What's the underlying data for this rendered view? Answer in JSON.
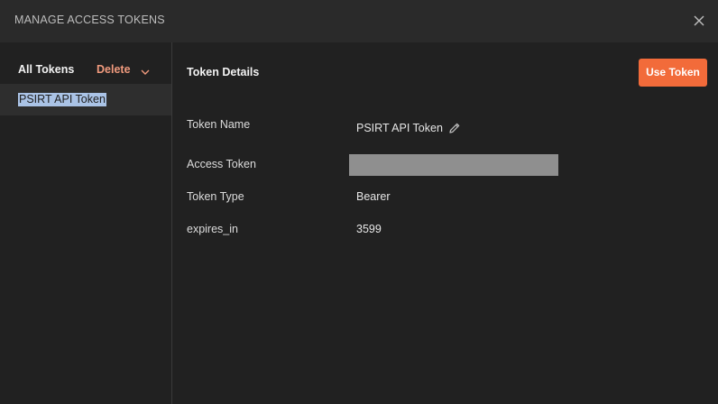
{
  "header": {
    "title": "MANAGE ACCESS TOKENS",
    "close_icon": "close-icon"
  },
  "sidebar": {
    "all_tokens_label": "All Tokens",
    "delete_label": "Delete",
    "delete_dropdown_icon": "chevron-down-icon",
    "tokens": [
      {
        "label": "PSIRT API Token",
        "selected": true
      }
    ]
  },
  "details": {
    "title": "Token Details",
    "use_token_label": "Use Token",
    "rows": [
      {
        "label": "Token Name",
        "value": "PSIRT API Token",
        "editable": true
      },
      {
        "label": "Access Token",
        "value": "",
        "redacted": true
      },
      {
        "label": "Token Type",
        "value": "Bearer"
      },
      {
        "label": "expires_in",
        "value": "3599"
      }
    ]
  },
  "colors": {
    "accent": "#f26b3a",
    "delete": "#f09a7d",
    "selection_highlight": "#aac3e6",
    "redaction": "#8f8f8f"
  }
}
